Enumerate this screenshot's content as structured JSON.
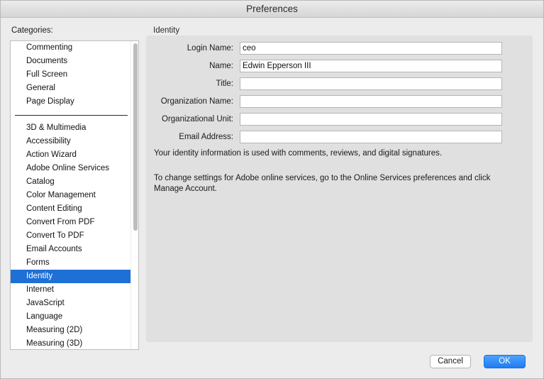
{
  "window": {
    "title": "Preferences"
  },
  "categories": {
    "label": "Categories:",
    "top_items": [
      {
        "label": "Commenting"
      },
      {
        "label": "Documents"
      },
      {
        "label": "Full Screen"
      },
      {
        "label": "General"
      },
      {
        "label": "Page Display"
      }
    ],
    "items": [
      {
        "label": "3D & Multimedia"
      },
      {
        "label": "Accessibility"
      },
      {
        "label": "Action Wizard"
      },
      {
        "label": "Adobe Online Services"
      },
      {
        "label": "Catalog"
      },
      {
        "label": "Color Management"
      },
      {
        "label": "Content Editing"
      },
      {
        "label": "Convert From PDF"
      },
      {
        "label": "Convert To PDF"
      },
      {
        "label": "Email Accounts"
      },
      {
        "label": "Forms"
      },
      {
        "label": "Identity"
      },
      {
        "label": "Internet"
      },
      {
        "label": "JavaScript"
      },
      {
        "label": "Language"
      },
      {
        "label": "Measuring (2D)"
      },
      {
        "label": "Measuring (3D)"
      }
    ],
    "selected": "Identity"
  },
  "identity": {
    "section_title": "Identity",
    "fields": [
      {
        "label": "Login Name:",
        "value": "ceo"
      },
      {
        "label": "Name:",
        "value": "Edwin Epperson III"
      },
      {
        "label": "Title:",
        "value": ""
      },
      {
        "label": "Organization Name:",
        "value": ""
      },
      {
        "label": "Organizational Unit:",
        "value": ""
      },
      {
        "label": "Email Address:",
        "value": ""
      }
    ],
    "info": "Your identity information is used with comments, reviews, and digital signatures.",
    "note": "To change settings for Adobe online services, go to the Online Services preferences and click Manage Account."
  },
  "buttons": {
    "cancel": "Cancel",
    "ok": "OK"
  }
}
